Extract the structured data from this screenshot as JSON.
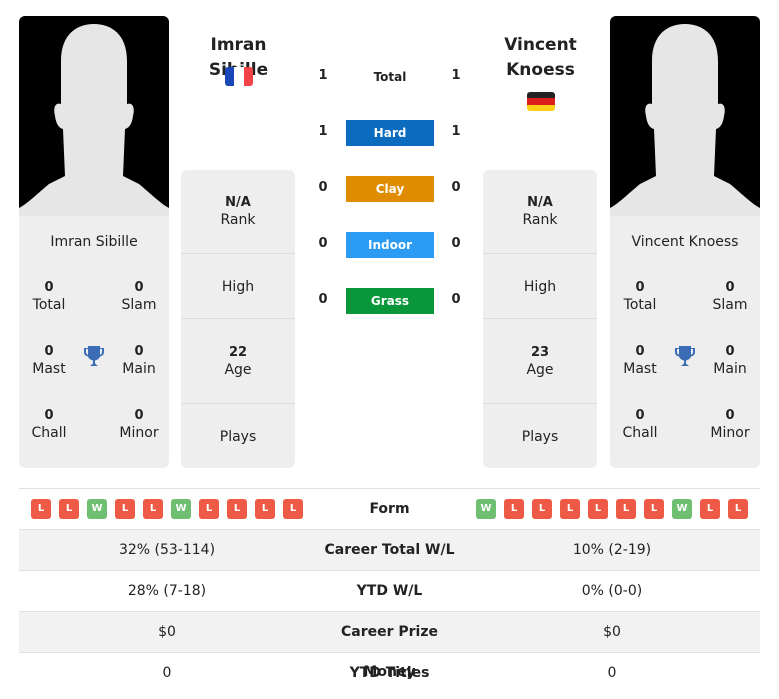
{
  "player1": {
    "name": "Imran Sibille",
    "country_flag": "france-flag",
    "card_name": "Imran Sibille",
    "titles": {
      "total": "0",
      "slam": "0",
      "mast": "0",
      "main": "0",
      "chall": "0",
      "minor": "0"
    },
    "rank": "N/A",
    "high": "",
    "age": "22",
    "plays": "",
    "form": [
      "L",
      "L",
      "W",
      "L",
      "L",
      "W",
      "L",
      "L",
      "L",
      "L"
    ],
    "career_wl": "32% (53-114)",
    "ytd_wl": "28% (7-18)",
    "prize": "$0",
    "ytd_titles": "0"
  },
  "player2": {
    "name": "Vincent Knoess",
    "country_flag": "germany-flag",
    "card_name": "Vincent Knoess",
    "titles": {
      "total": "0",
      "slam": "0",
      "mast": "0",
      "main": "0",
      "chall": "0",
      "minor": "0"
    },
    "rank": "N/A",
    "high": "",
    "age": "23",
    "plays": "",
    "form": [
      "W",
      "L",
      "L",
      "L",
      "L",
      "L",
      "L",
      "W",
      "L",
      "L"
    ],
    "career_wl": "10% (2-19)",
    "ytd_wl": "0% (0-0)",
    "prize": "$0",
    "ytd_titles": "0"
  },
  "labels": {
    "total": "Total",
    "slam": "Slam",
    "mast": "Mast",
    "main": "Main",
    "chall": "Chall",
    "minor": "Minor",
    "rank": "Rank",
    "high": "High",
    "age": "Age",
    "plays": "Plays",
    "form": "Form",
    "career_wl": "Career Total W/L",
    "ytd_wl": "YTD W/L",
    "prize": "Career Prize Money",
    "ytd_titles": "YTD Titles"
  },
  "h2h": {
    "total": {
      "label": "Total",
      "p1": "1",
      "p2": "1"
    },
    "surfaces": [
      {
        "label": "Hard",
        "p1": "1",
        "p2": "1",
        "color": "#0a6bbf"
      },
      {
        "label": "Clay",
        "p1": "0",
        "p2": "0",
        "color": "#e08c00"
      },
      {
        "label": "Indoor",
        "p1": "0",
        "p2": "0",
        "color": "#2b9bf4"
      },
      {
        "label": "Grass",
        "p1": "0",
        "p2": "0",
        "color": "#0a963a"
      }
    ]
  },
  "colors": {
    "loss": "#ee5a45",
    "win": "#6fbf73",
    "trophy": "#3a6db5"
  }
}
